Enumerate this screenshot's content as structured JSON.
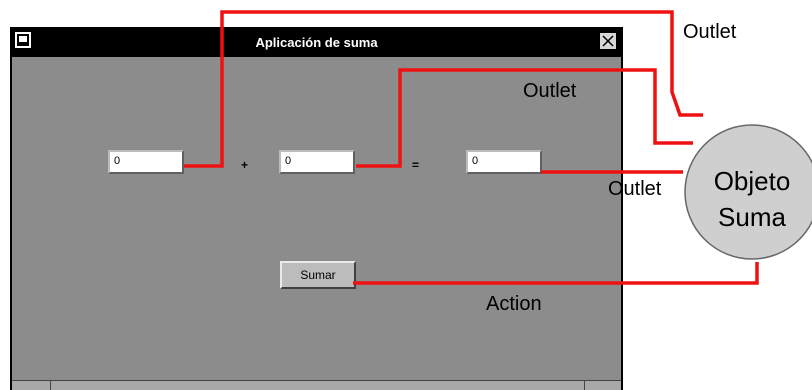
{
  "window": {
    "title": "Aplicación de suma"
  },
  "fields": {
    "first": "0",
    "second": "0",
    "result": "0"
  },
  "operators": {
    "plus": "+",
    "equals": "="
  },
  "button": {
    "label": "Sumar"
  },
  "annotations": {
    "outlet_1": "Outlet",
    "outlet_2": "Outlet",
    "outlet_3": "Outlet",
    "action": "Action",
    "object_line1": "Objeto",
    "object_line2": "Suma"
  },
  "colors": {
    "connector": "#ee1111",
    "window_bg": "#8c8c8c",
    "object_fill": "#cfcfcf"
  }
}
